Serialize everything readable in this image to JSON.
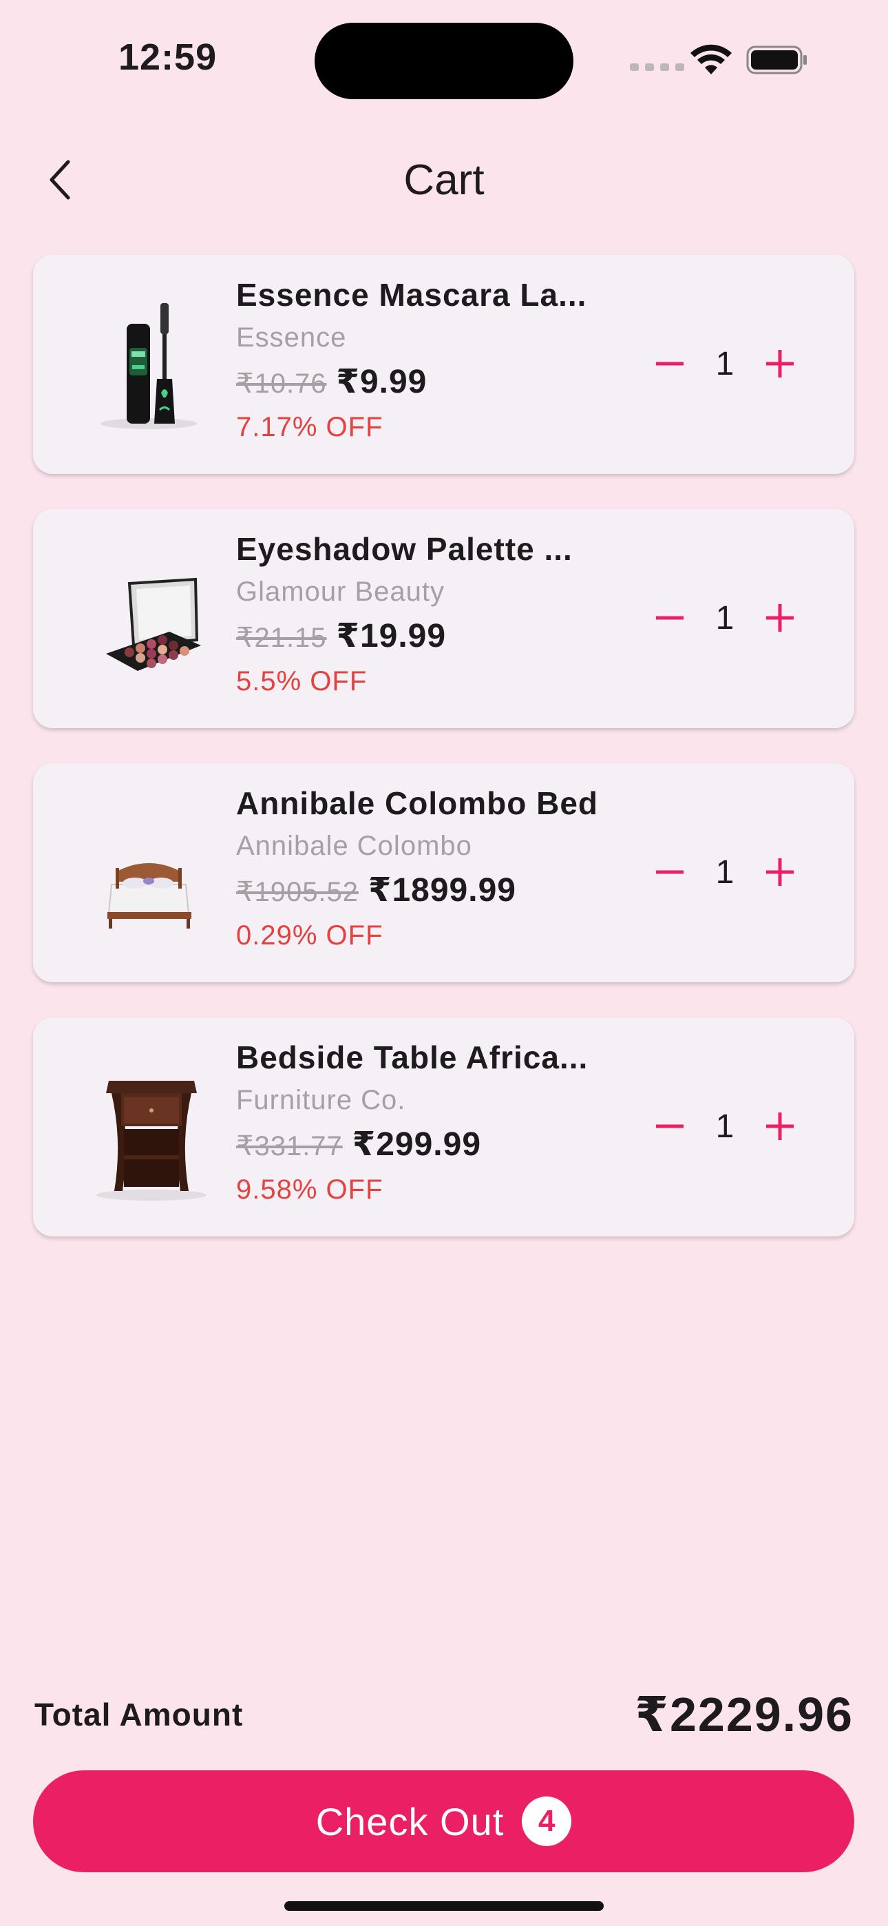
{
  "status": {
    "time": "12:59"
  },
  "header": {
    "title": "Cart"
  },
  "items": [
    {
      "name": "Essence Mascara La...",
      "brand": "Essence",
      "old_price": "₹10.76",
      "price": "₹9.99",
      "discount": "7.17% OFF",
      "qty": "1",
      "image": "mascara-image"
    },
    {
      "name": "Eyeshadow Palette ...",
      "brand": "Glamour Beauty",
      "old_price": "₹21.15",
      "price": "₹19.99",
      "discount": "5.5% OFF",
      "qty": "1",
      "image": "eyeshadow-palette-image"
    },
    {
      "name": "Annibale Colombo Bed",
      "brand": "Annibale Colombo",
      "old_price": "₹1905.52",
      "price": "₹1899.99",
      "discount": "0.29% OFF",
      "qty": "1",
      "image": "bed-image"
    },
    {
      "name": "Bedside Table Africa...",
      "brand": "Furniture Co.",
      "old_price": "₹331.77",
      "price": "₹299.99",
      "discount": "9.58% OFF",
      "qty": "1",
      "image": "bedside-table-image"
    }
  ],
  "footer": {
    "total_label": "Total Amount",
    "total_value": "₹2229.96",
    "checkout_label": "Check Out",
    "checkout_count": "4"
  },
  "colors": {
    "accent": "#eb1f63",
    "background": "#fbe4ec",
    "card": "#f5f0f6",
    "discount": "#e5423f"
  }
}
